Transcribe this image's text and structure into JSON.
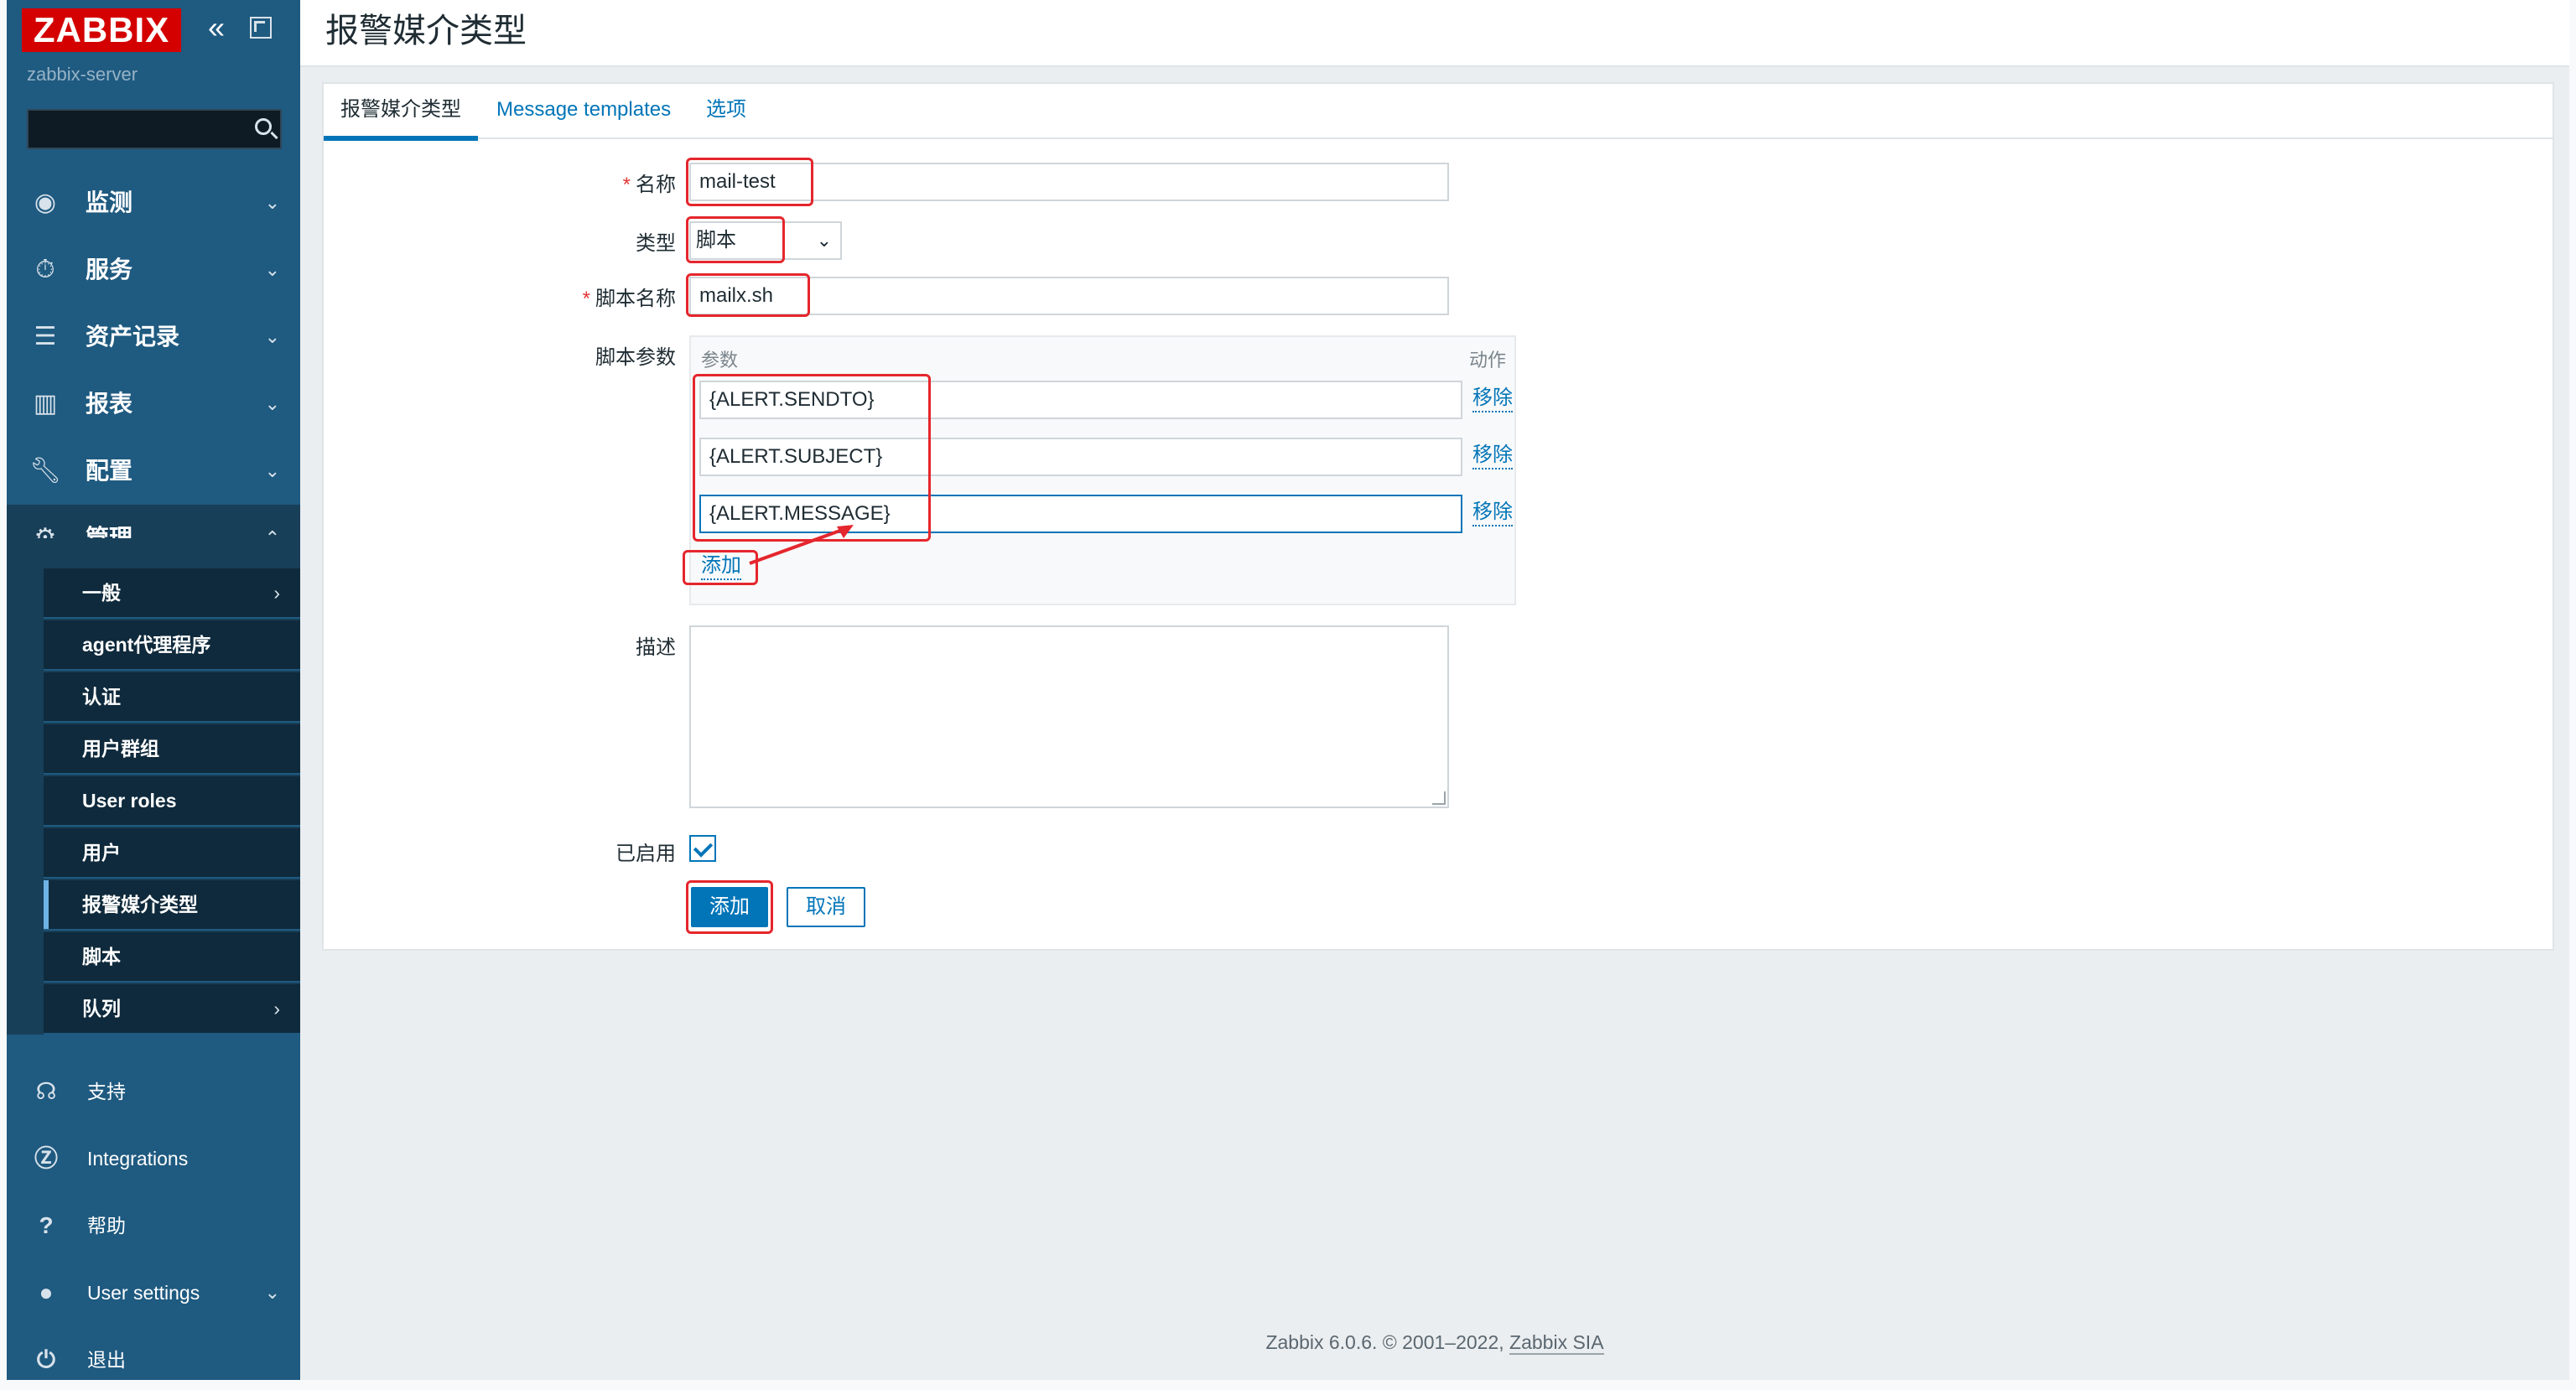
{
  "brand": {
    "logo": "ZABBIX",
    "server_name": "zabbix-server",
    "accent": "#d40000",
    "sidebar_bg": "#1f5a80"
  },
  "sidebar": {
    "collapse_icon": "double-chevron-left-icon",
    "search_placeholder": "",
    "menu": [
      {
        "label": "监测",
        "icon": "eye-icon"
      },
      {
        "label": "服务",
        "icon": "stopwatch-icon"
      },
      {
        "label": "资产记录",
        "icon": "list-icon"
      },
      {
        "label": "报表",
        "icon": "bar-chart-icon"
      },
      {
        "label": "配置",
        "icon": "wrench-icon"
      },
      {
        "label": "管理",
        "icon": "gear-icon",
        "expanded": true
      }
    ],
    "submenu": [
      {
        "label": "一般",
        "has_children": true
      },
      {
        "label": "agent代理程序"
      },
      {
        "label": "认证"
      },
      {
        "label": "用户群组"
      },
      {
        "label": "User roles"
      },
      {
        "label": "用户"
      },
      {
        "label": "报警媒介类型",
        "selected": true
      },
      {
        "label": "脚本"
      },
      {
        "label": "队列",
        "has_children": true
      }
    ],
    "bottom": [
      {
        "label": "支持",
        "icon": "headset-icon"
      },
      {
        "label": "Integrations",
        "icon": "z-icon"
      },
      {
        "label": "帮助",
        "icon": "question-icon"
      },
      {
        "label": "User settings",
        "icon": "user-icon"
      },
      {
        "label": "退出",
        "icon": "power-icon"
      }
    ]
  },
  "page": {
    "title": "报警媒介类型"
  },
  "tabs": [
    {
      "label": "报警媒介类型",
      "active": true
    },
    {
      "label": "Message templates"
    },
    {
      "label": "选项"
    }
  ],
  "form": {
    "name_label": "名称",
    "name_value": "mail-test",
    "type_label": "类型",
    "type_value": "脚本",
    "script_name_label": "脚本名称",
    "script_name_value": "mailx.sh",
    "params_label": "脚本参数",
    "params_col_param": "参数",
    "params_col_action": "动作",
    "params": [
      {
        "value": "{ALERT.SENDTO}",
        "remove": "移除"
      },
      {
        "value": "{ALERT.SUBJECT}",
        "remove": "移除"
      },
      {
        "value": "{ALERT.MESSAGE}",
        "remove": "移除"
      }
    ],
    "params_add": "添加",
    "description_label": "描述",
    "description_value": "",
    "enabled_label": "已启用",
    "enabled": true,
    "submit": "添加",
    "cancel": "取消"
  },
  "footer": {
    "text": "Zabbix 6.0.6. © 2001–2022, ",
    "link": "Zabbix SIA"
  },
  "annotation_color": "#e5262d"
}
